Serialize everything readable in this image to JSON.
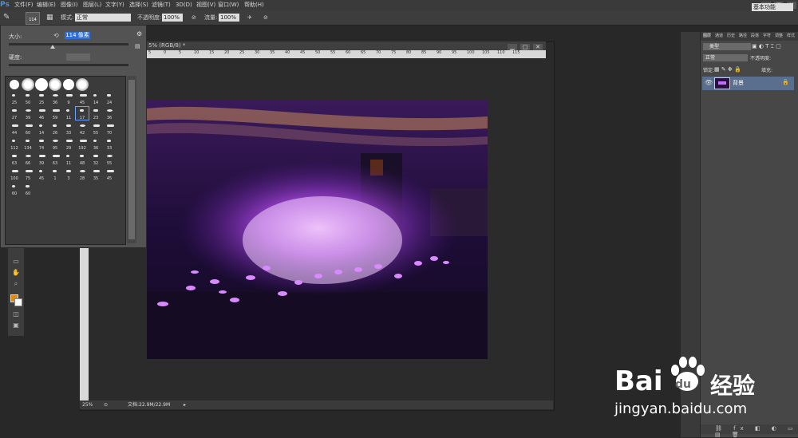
{
  "app": {
    "logo": "Ps"
  },
  "menu": [
    "文件(F)",
    "编辑(E)",
    "图像(I)",
    "图层(L)",
    "文字(Y)",
    "选择(S)",
    "滤镜(T)",
    "3D(D)",
    "视图(V)",
    "窗口(W)",
    "帮助(H)"
  ],
  "window_controls": [
    "—",
    "□",
    "✕"
  ],
  "options": {
    "brush_size": "114",
    "mode_label": "模式:",
    "mode_value": "正常",
    "opacity_label": "不透明度:",
    "opacity_value": "100%",
    "flow_label": "流量:",
    "flow_value": "100%",
    "workspace": "基本功能"
  },
  "brush_panel": {
    "size_label": "大小:",
    "size_value": "114 像素",
    "hardness_label": "硬度:",
    "brush_numbers": [
      "25",
      "50",
      "25",
      "36",
      "9",
      "45",
      "14",
      "24",
      "27",
      "39",
      "46",
      "59",
      "11",
      "17",
      "23",
      "36",
      "44",
      "60",
      "14",
      "26",
      "33",
      "42",
      "55",
      "70",
      "112",
      "134",
      "74",
      "95",
      "29",
      "192",
      "36",
      "33",
      "63",
      "66",
      "39",
      "63",
      "11",
      "48",
      "32",
      "55",
      "100",
      "75",
      "45",
      "1",
      "3",
      "28",
      "35",
      "45",
      "60",
      "60"
    ]
  },
  "document": {
    "tab_title": "5% (RGB/8) *",
    "ruler_ticks": [
      "5",
      "0",
      "5",
      "10",
      "15",
      "20",
      "25",
      "30",
      "35",
      "40",
      "45",
      "50",
      "55",
      "60",
      "65",
      "70",
      "75",
      "80",
      "85",
      "90",
      "95",
      "100",
      "105",
      "110",
      "115"
    ],
    "zoom": "25%",
    "doc_info": "文档:22.9M/22.9M"
  },
  "layers_panel": {
    "tabs": [
      "图层",
      "通道",
      "历史",
      "路径",
      "段落",
      "字符",
      "调整",
      "样式"
    ],
    "filter_kind": "类型",
    "blend_mode": "正常",
    "opacity_label": "不透明度:",
    "lock_label": "锁定:",
    "fill_label": "填充:",
    "layer_name": "背景"
  },
  "watermark": {
    "brand": "Bai",
    "brand2": "du",
    "jingyan": "经验",
    "url": "jingyan.baidu.com"
  }
}
